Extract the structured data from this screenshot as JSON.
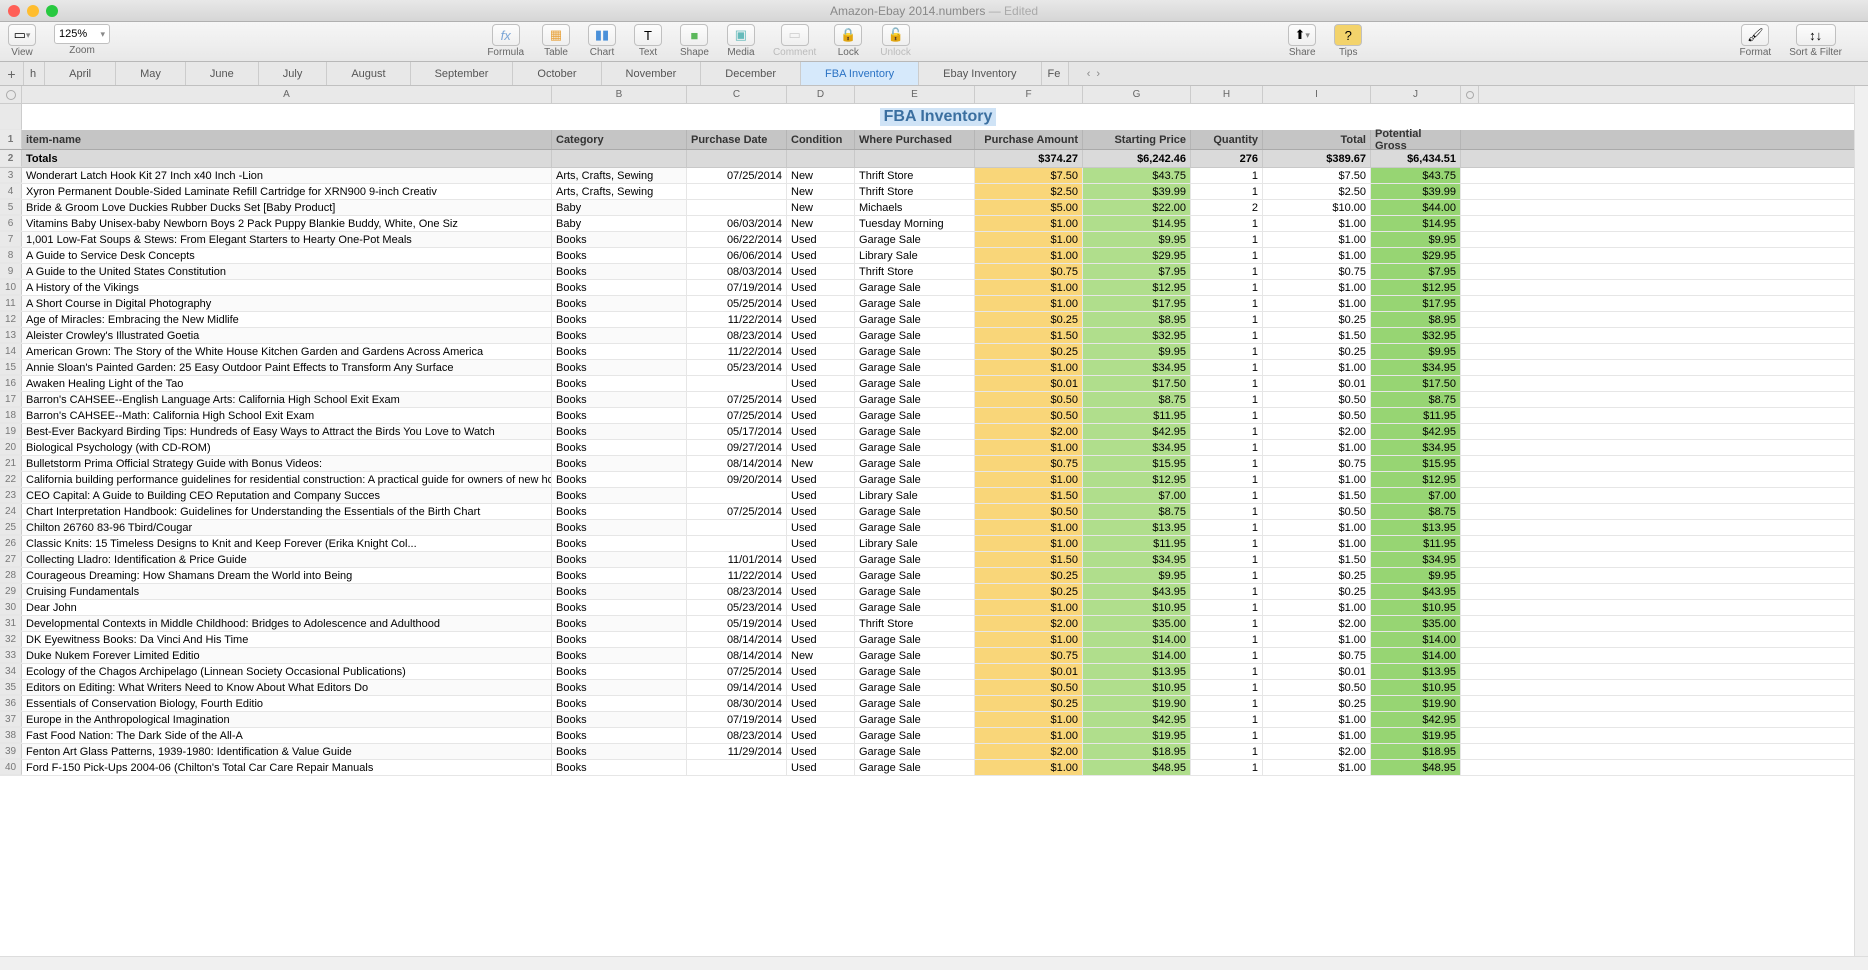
{
  "window": {
    "doc_title": "Amazon-Ebay 2014.numbers",
    "edited": "— Edited",
    "zoom": "125%"
  },
  "toolbar": {
    "view": "View",
    "zoom": "Zoom",
    "formula": "Formula",
    "table": "Table",
    "chart": "Chart",
    "text": "Text",
    "shape": "Shape",
    "media": "Media",
    "comment": "Comment",
    "lock": "Lock",
    "unlock": "Unlock",
    "share": "Share",
    "tips": "Tips",
    "format": "Format",
    "sort_filter": "Sort & Filter"
  },
  "sheets": {
    "truncated_first": "h",
    "tabs": [
      "April",
      "May",
      "June",
      "July",
      "August",
      "September",
      "October",
      "November",
      "December",
      "FBA Inventory",
      "Ebay Inventory"
    ],
    "truncated_last": "Fe",
    "active": "FBA Inventory"
  },
  "columns": [
    "A",
    "B",
    "C",
    "D",
    "E",
    "F",
    "G",
    "H",
    "I",
    "J"
  ],
  "sheet_title": "FBA Inventory",
  "headers": {
    "item": "item-name",
    "category": "Category",
    "purchase_date": "Purchase Date",
    "condition": "Condition",
    "where": "Where Purchased",
    "amount": "Purchase Amount",
    "price": "Starting Price",
    "qty": "Quantity",
    "total": "Total",
    "gross": "Potential Gross"
  },
  "totals": {
    "label": "Totals",
    "amount": "$374.27",
    "price": "$6,242.46",
    "qty": "276",
    "total": "$389.67",
    "gross": "$6,434.51"
  },
  "rows": [
    {
      "n": 3,
      "item": "Wonderart Latch Hook Kit 27 Inch x40 Inch -Lion",
      "cat": "Arts, Crafts, Sewing",
      "date": "07/25/2014",
      "cond": "New",
      "where": "Thrift Store",
      "amt": "$7.50",
      "price": "$43.75",
      "qty": "1",
      "tot": "$7.50",
      "gross": "$43.75"
    },
    {
      "n": 4,
      "item": "Xyron Permanent Double-Sided Laminate Refill Cartridge for XRN900 9-inch Creativ",
      "cat": "Arts, Crafts, Sewing",
      "date": "",
      "cond": "New",
      "where": "Thrift Store",
      "amt": "$2.50",
      "price": "$39.99",
      "qty": "1",
      "tot": "$2.50",
      "gross": "$39.99"
    },
    {
      "n": 5,
      "item": "Bride & Groom Love Duckies Rubber Ducks Set [Baby Product]",
      "cat": "Baby",
      "date": "",
      "cond": "New",
      "where": "Michaels",
      "amt": "$5.00",
      "price": "$22.00",
      "qty": "2",
      "tot": "$10.00",
      "gross": "$44.00"
    },
    {
      "n": 6,
      "item": "Vitamins Baby Unisex-baby Newborn Boys 2 Pack Puppy Blankie Buddy, White, One Siz",
      "cat": "Baby",
      "date": "06/03/2014",
      "cond": "New",
      "where": "Tuesday Morning",
      "amt": "$1.00",
      "price": "$14.95",
      "qty": "1",
      "tot": "$1.00",
      "gross": "$14.95"
    },
    {
      "n": 7,
      "item": "1,001 Low-Fat Soups & Stews: From Elegant Starters to Hearty One-Pot Meals",
      "cat": "Books",
      "date": "06/22/2014",
      "cond": "Used",
      "where": "Garage Sale",
      "amt": "$1.00",
      "price": "$9.95",
      "qty": "1",
      "tot": "$1.00",
      "gross": "$9.95"
    },
    {
      "n": 8,
      "item": "A Guide to Service Desk Concepts",
      "cat": "Books",
      "date": "06/06/2014",
      "cond": "Used",
      "where": "Library Sale",
      "amt": "$1.00",
      "price": "$29.95",
      "qty": "1",
      "tot": "$1.00",
      "gross": "$29.95"
    },
    {
      "n": 9,
      "item": "A Guide to the United States Constitution",
      "cat": "Books",
      "date": "08/03/2014",
      "cond": "Used",
      "where": "Thrift Store",
      "amt": "$0.75",
      "price": "$7.95",
      "qty": "1",
      "tot": "$0.75",
      "gross": "$7.95"
    },
    {
      "n": 10,
      "item": "A History of the Vikings",
      "cat": "Books",
      "date": "07/19/2014",
      "cond": "Used",
      "where": "Garage Sale",
      "amt": "$1.00",
      "price": "$12.95",
      "qty": "1",
      "tot": "$1.00",
      "gross": "$12.95"
    },
    {
      "n": 11,
      "item": "A Short Course in Digital Photography",
      "cat": "Books",
      "date": "05/25/2014",
      "cond": "Used",
      "where": "Garage Sale",
      "amt": "$1.00",
      "price": "$17.95",
      "qty": "1",
      "tot": "$1.00",
      "gross": "$17.95"
    },
    {
      "n": 12,
      "item": "Age of Miracles: Embracing the New Midlife",
      "cat": "Books",
      "date": "11/22/2014",
      "cond": "Used",
      "where": "Garage Sale",
      "amt": "$0.25",
      "price": "$8.95",
      "qty": "1",
      "tot": "$0.25",
      "gross": "$8.95"
    },
    {
      "n": 13,
      "item": "Aleister Crowley's Illustrated Goetia",
      "cat": "Books",
      "date": "08/23/2014",
      "cond": "Used",
      "where": "Garage Sale",
      "amt": "$1.50",
      "price": "$32.95",
      "qty": "1",
      "tot": "$1.50",
      "gross": "$32.95"
    },
    {
      "n": 14,
      "item": "American Grown: The Story of the White House Kitchen Garden and Gardens Across America",
      "cat": "Books",
      "date": "11/22/2014",
      "cond": "Used",
      "where": "Garage Sale",
      "amt": "$0.25",
      "price": "$9.95",
      "qty": "1",
      "tot": "$0.25",
      "gross": "$9.95"
    },
    {
      "n": 15,
      "item": "Annie Sloan's Painted Garden: 25 Easy Outdoor Paint Effects to Transform Any Surface",
      "cat": "Books",
      "date": "05/23/2014",
      "cond": "Used",
      "where": "Garage Sale",
      "amt": "$1.00",
      "price": "$34.95",
      "qty": "1",
      "tot": "$1.00",
      "gross": "$34.95"
    },
    {
      "n": 16,
      "item": "Awaken Healing Light of the Tao",
      "cat": "Books",
      "date": "",
      "cond": "Used",
      "where": "Garage Sale",
      "amt": "$0.01",
      "price": "$17.50",
      "qty": "1",
      "tot": "$0.01",
      "gross": "$17.50"
    },
    {
      "n": 17,
      "item": "Barron's CAHSEE--English Language Arts: California High School Exit Exam",
      "cat": "Books",
      "date": "07/25/2014",
      "cond": "Used",
      "where": "Garage Sale",
      "amt": "$0.50",
      "price": "$8.75",
      "qty": "1",
      "tot": "$0.50",
      "gross": "$8.75"
    },
    {
      "n": 18,
      "item": "Barron's CAHSEE--Math: California High School Exit Exam",
      "cat": "Books",
      "date": "07/25/2014",
      "cond": "Used",
      "where": "Garage Sale",
      "amt": "$0.50",
      "price": "$11.95",
      "qty": "1",
      "tot": "$0.50",
      "gross": "$11.95"
    },
    {
      "n": 19,
      "item": "Best-Ever Backyard Birding Tips: Hundreds of Easy Ways to Attract the Birds You Love to Watch",
      "cat": "Books",
      "date": "05/17/2014",
      "cond": "Used",
      "where": "Garage Sale",
      "amt": "$2.00",
      "price": "$42.95",
      "qty": "1",
      "tot": "$2.00",
      "gross": "$42.95"
    },
    {
      "n": 20,
      "item": "Biological Psychology (with CD-ROM)",
      "cat": "Books",
      "date": "09/27/2014",
      "cond": "Used",
      "where": "Garage Sale",
      "amt": "$1.00",
      "price": "$34.95",
      "qty": "1",
      "tot": "$1.00",
      "gross": "$34.95"
    },
    {
      "n": 21,
      "item": "Bulletstorm Prima Official Strategy Guide with Bonus Videos:",
      "cat": "Books",
      "date": "08/14/2014",
      "cond": "New",
      "where": "Garage Sale",
      "amt": "$0.75",
      "price": "$15.95",
      "qty": "1",
      "tot": "$0.75",
      "gross": "$15.95"
    },
    {
      "n": 22,
      "item": "California building performance guidelines for residential construction: A practical guide for owners of new homes : constr",
      "cat": "Books",
      "date": "09/20/2014",
      "cond": "Used",
      "where": "Garage Sale",
      "amt": "$1.00",
      "price": "$12.95",
      "qty": "1",
      "tot": "$1.00",
      "gross": "$12.95"
    },
    {
      "n": 23,
      "item": "CEO Capital: A Guide to Building CEO Reputation and Company Succes",
      "cat": "Books",
      "date": "",
      "cond": "Used",
      "where": "Library Sale",
      "amt": "$1.50",
      "price": "$7.00",
      "qty": "1",
      "tot": "$1.50",
      "gross": "$7.00"
    },
    {
      "n": 24,
      "item": "Chart Interpretation Handbook: Guidelines for Understanding the Essentials of the Birth Chart",
      "cat": "Books",
      "date": "07/25/2014",
      "cond": "Used",
      "where": "Garage Sale",
      "amt": "$0.50",
      "price": "$8.75",
      "qty": "1",
      "tot": "$0.50",
      "gross": "$8.75"
    },
    {
      "n": 25,
      "item": "Chilton 26760 83-96 Tbird/Cougar",
      "cat": "Books",
      "date": "",
      "cond": "Used",
      "where": "Garage Sale",
      "amt": "$1.00",
      "price": "$13.95",
      "qty": "1",
      "tot": "$1.00",
      "gross": "$13.95"
    },
    {
      "n": 26,
      "item": "Classic Knits: 15 Timeless Designs to Knit and Keep Forever (Erika Knight Col...",
      "cat": "Books",
      "date": "",
      "cond": "Used",
      "where": "Library Sale",
      "amt": "$1.00",
      "price": "$11.95",
      "qty": "1",
      "tot": "$1.00",
      "gross": "$11.95"
    },
    {
      "n": 27,
      "item": "Collecting Lladro: Identification & Price Guide",
      "cat": "Books",
      "date": "11/01/2014",
      "cond": "Used",
      "where": "Garage Sale",
      "amt": "$1.50",
      "price": "$34.95",
      "qty": "1",
      "tot": "$1.50",
      "gross": "$34.95"
    },
    {
      "n": 28,
      "item": "Courageous Dreaming: How Shamans Dream the World into Being",
      "cat": "Books",
      "date": "11/22/2014",
      "cond": "Used",
      "where": "Garage Sale",
      "amt": "$0.25",
      "price": "$9.95",
      "qty": "1",
      "tot": "$0.25",
      "gross": "$9.95"
    },
    {
      "n": 29,
      "item": "Cruising Fundamentals",
      "cat": "Books",
      "date": "08/23/2014",
      "cond": "Used",
      "where": "Garage Sale",
      "amt": "$0.25",
      "price": "$43.95",
      "qty": "1",
      "tot": "$0.25",
      "gross": "$43.95"
    },
    {
      "n": 30,
      "item": "Dear John",
      "cat": "Books",
      "date": "05/23/2014",
      "cond": "Used",
      "where": "Garage Sale",
      "amt": "$1.00",
      "price": "$10.95",
      "qty": "1",
      "tot": "$1.00",
      "gross": "$10.95"
    },
    {
      "n": 31,
      "item": "Developmental Contexts in Middle Childhood: Bridges to Adolescence and Adulthood",
      "cat": "Books",
      "date": "05/19/2014",
      "cond": "Used",
      "where": "Thrift Store",
      "amt": "$2.00",
      "price": "$35.00",
      "qty": "1",
      "tot": "$2.00",
      "gross": "$35.00"
    },
    {
      "n": 32,
      "item": "DK Eyewitness Books: Da Vinci And His Time",
      "cat": "Books",
      "date": "08/14/2014",
      "cond": "Used",
      "where": "Garage Sale",
      "amt": "$1.00",
      "price": "$14.00",
      "qty": "1",
      "tot": "$1.00",
      "gross": "$14.00"
    },
    {
      "n": 33,
      "item": "Duke Nukem Forever Limited Editio",
      "cat": "Books",
      "date": "08/14/2014",
      "cond": "New",
      "where": "Garage Sale",
      "amt": "$0.75",
      "price": "$14.00",
      "qty": "1",
      "tot": "$0.75",
      "gross": "$14.00"
    },
    {
      "n": 34,
      "item": "Ecology of the Chagos Archipelago (Linnean Society Occasional Publications)",
      "cat": "Books",
      "date": "07/25/2014",
      "cond": "Used",
      "where": "Garage Sale",
      "amt": "$0.01",
      "price": "$13.95",
      "qty": "1",
      "tot": "$0.01",
      "gross": "$13.95"
    },
    {
      "n": 35,
      "item": "Editors on Editing: What Writers Need to Know About What Editors Do",
      "cat": "Books",
      "date": "09/14/2014",
      "cond": "Used",
      "where": "Garage Sale",
      "amt": "$0.50",
      "price": "$10.95",
      "qty": "1",
      "tot": "$0.50",
      "gross": "$10.95"
    },
    {
      "n": 36,
      "item": "Essentials of Conservation Biology, Fourth Editio",
      "cat": "Books",
      "date": "08/30/2014",
      "cond": "Used",
      "where": "Garage Sale",
      "amt": "$0.25",
      "price": "$19.90",
      "qty": "1",
      "tot": "$0.25",
      "gross": "$19.90"
    },
    {
      "n": 37,
      "item": "Europe in the Anthropological Imagination",
      "cat": "Books",
      "date": "07/19/2014",
      "cond": "Used",
      "where": "Garage Sale",
      "amt": "$1.00",
      "price": "$42.95",
      "qty": "1",
      "tot": "$1.00",
      "gross": "$42.95"
    },
    {
      "n": 38,
      "item": "Fast Food Nation: The Dark Side of the All-A",
      "cat": "Books",
      "date": "08/23/2014",
      "cond": "Used",
      "where": "Garage Sale",
      "amt": "$1.00",
      "price": "$19.95",
      "qty": "1",
      "tot": "$1.00",
      "gross": "$19.95"
    },
    {
      "n": 39,
      "item": "Fenton Art Glass Patterns, 1939-1980: Identification & Value Guide",
      "cat": "Books",
      "date": "11/29/2014",
      "cond": "Used",
      "where": "Garage Sale",
      "amt": "$2.00",
      "price": "$18.95",
      "qty": "1",
      "tot": "$2.00",
      "gross": "$18.95"
    },
    {
      "n": 40,
      "item": "Ford F-150 Pick-Ups 2004-06 (Chilton's Total Car Care Repair Manuals",
      "cat": "Books",
      "date": "",
      "cond": "Used",
      "where": "Garage Sale",
      "amt": "$1.00",
      "price": "$48.95",
      "qty": "1",
      "tot": "$1.00",
      "gross": "$48.95"
    }
  ]
}
